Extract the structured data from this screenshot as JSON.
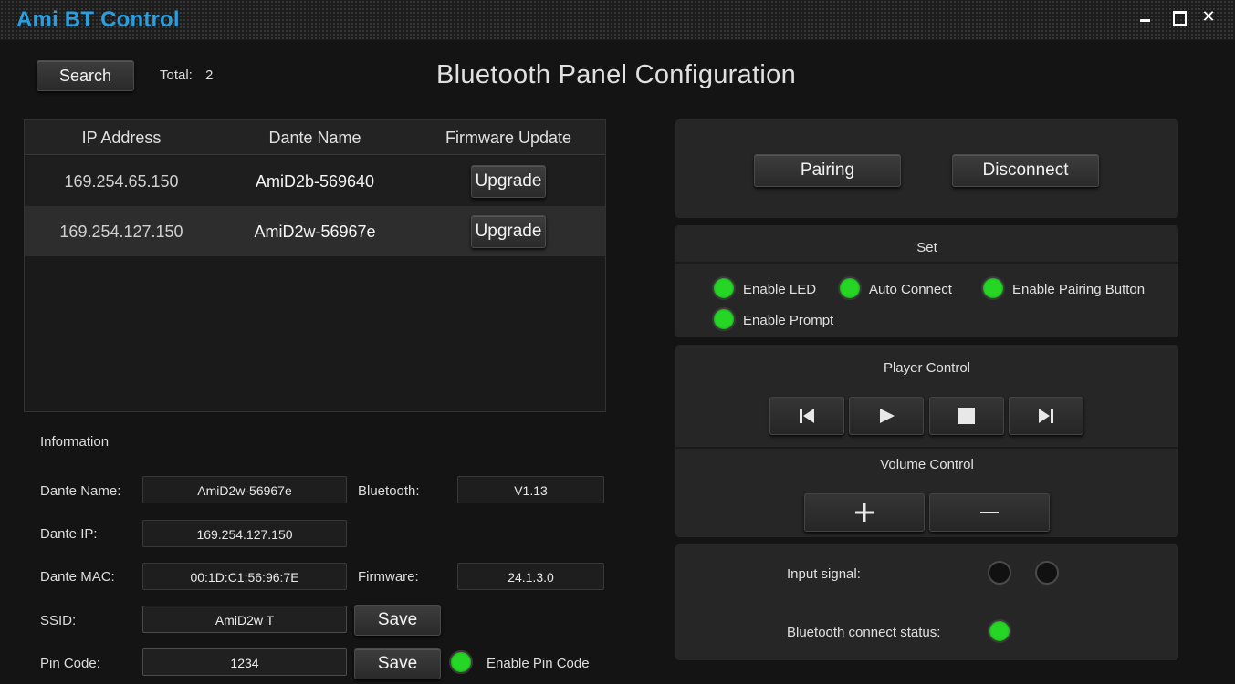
{
  "window": {
    "title": "Ami BT Control"
  },
  "toolbar": {
    "search_label": "Search",
    "total_label": "Total:",
    "total_value": "2"
  },
  "page_title": "Bluetooth Panel Configuration",
  "device_table": {
    "columns": [
      "IP Address",
      "Dante Name",
      "Firmware Update"
    ],
    "rows": [
      {
        "ip": "169.254.65.150",
        "name": "AmiD2b-569640",
        "action": "Upgrade"
      },
      {
        "ip": "169.254.127.150",
        "name": "AmiD2w-56967e",
        "action": "Upgrade"
      }
    ]
  },
  "information": {
    "title": "Information",
    "dante_name_label": "Dante Name:",
    "dante_name": "AmiD2w-56967e",
    "bluetooth_label": "Bluetooth:",
    "bluetooth": "V1.13",
    "dante_ip_label": "Dante IP:",
    "dante_ip": "169.254.127.150",
    "dante_mac_label": "Dante MAC:",
    "dante_mac": "00:1D:C1:56:96:7E",
    "firmware_label": "Firmware:",
    "firmware": "24.1.3.0",
    "ssid_label": "SSID:",
    "ssid": "AmiD2w T",
    "pin_label": "Pin Code:",
    "pin": "1234",
    "save_label": "Save",
    "enable_pin_label": "Enable Pin Code"
  },
  "pairing": {
    "pair_label": "Pairing",
    "disconnect_label": "Disconnect"
  },
  "set": {
    "title": "Set",
    "options": [
      "Enable LED",
      "Auto Connect",
      "Enable Pairing Button",
      "Enable Prompt"
    ]
  },
  "player": {
    "title": "Player Control",
    "buttons": [
      "previous-icon",
      "play-icon",
      "stop-icon",
      "next-icon"
    ]
  },
  "volume": {
    "title": "Volume Control",
    "buttons": [
      "plus-icon",
      "minus-icon"
    ]
  },
  "status": {
    "input_signal_label": "Input signal:",
    "bt_status_label": "Bluetooth connect status:"
  },
  "colors": {
    "accent": "#2a9fe0",
    "led_on": "#25d625",
    "background": "#141414",
    "panel": "#262626"
  }
}
